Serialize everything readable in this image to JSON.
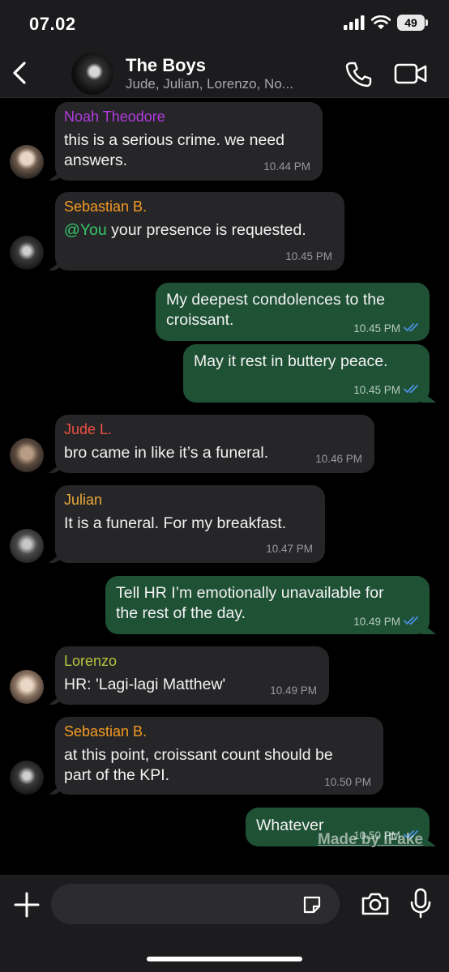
{
  "status": {
    "time": "07.02",
    "battery": "49"
  },
  "header": {
    "title": "The Boys",
    "members": "Jude, Julian, Lorenzo, No..."
  },
  "colors": {
    "incoming_bubble": "#262628",
    "outgoing_bubble": "#1f5135",
    "read_check": "#4a90e2",
    "noah": "#b23be0",
    "sebastian": "#f59a23",
    "jude": "#ef4f42",
    "julian": "#e9a93a",
    "lorenzo": "#b6c441",
    "mention": "#35c66a"
  },
  "messages": [
    {
      "direction": "in",
      "sender": "Noah Theodore",
      "lines": [
        "this is a serious crime. we need",
        "answers."
      ],
      "time": "10.44 PM"
    },
    {
      "direction": "in",
      "sender": "Sebastian B.",
      "mention": "@You",
      "text": " your presence is requested.",
      "time": "10.45 PM"
    },
    {
      "direction": "out",
      "lines": [
        "My deepest condolences to the",
        "croissant."
      ],
      "time": "10.45 PM",
      "read": true
    },
    {
      "direction": "out",
      "lines": [
        "May it rest in buttery peace."
      ],
      "time": "10.45 PM",
      "read": true
    },
    {
      "direction": "in",
      "sender": "Jude L.",
      "lines": [
        "bro came in like it’s a funeral."
      ],
      "time": "10.46 PM"
    },
    {
      "direction": "in",
      "sender": "Julian",
      "lines": [
        "It is a funeral. For my breakfast."
      ],
      "time": "10.47 PM"
    },
    {
      "direction": "out",
      "lines": [
        "Tell HR I’m emotionally unavailable for",
        "the rest of the day."
      ],
      "time": "10.49 PM",
      "read": true
    },
    {
      "direction": "in",
      "sender": "Lorenzo",
      "lines": [
        "HR: 'Lagi-lagi Matthew'"
      ],
      "time": "10.49 PM"
    },
    {
      "direction": "in",
      "sender": "Sebastian B.",
      "lines": [
        "at this point, croissant count should be",
        "part of the KPI."
      ],
      "time": "10.50 PM"
    },
    {
      "direction": "out",
      "lines": [
        "Whatever"
      ],
      "time": "10.50 PM",
      "read": true
    }
  ],
  "watermark": "Made by iFake",
  "composer": {
    "placeholder": ""
  },
  "icons": [
    "back-chevron-icon",
    "phone-icon",
    "video-camera-icon",
    "plus-icon",
    "sticker-icon",
    "camera-icon",
    "microphone-icon",
    "double-check-icon",
    "signal-icon",
    "wifi-icon",
    "battery-icon"
  ]
}
